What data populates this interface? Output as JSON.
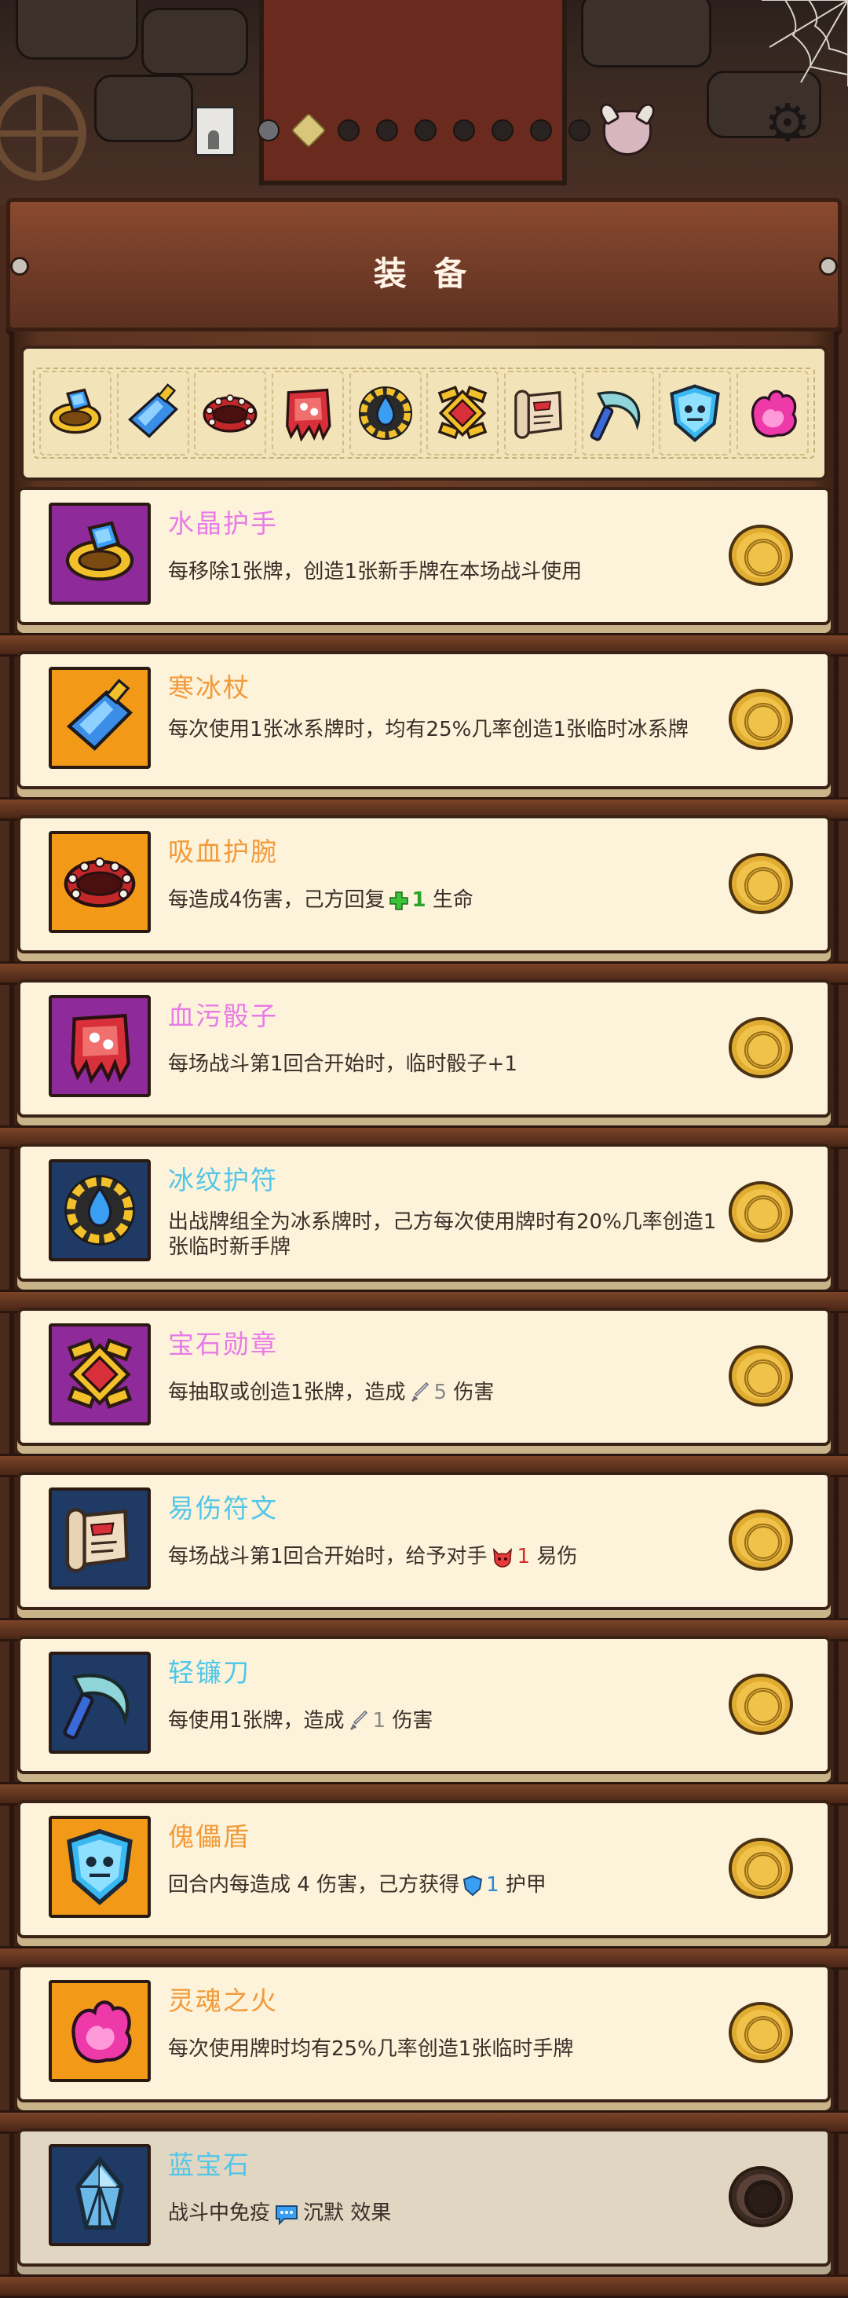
{
  "header": {
    "title": "装 备",
    "stage_dots": [
      {
        "state": "grey"
      },
      {
        "state": "active"
      },
      {
        "state": "dark"
      },
      {
        "state": "dark"
      },
      {
        "state": "dark"
      },
      {
        "state": "dark"
      },
      {
        "state": "dark"
      },
      {
        "state": "dark"
      },
      {
        "state": "dark"
      }
    ],
    "icons": [
      "castle-icon",
      "skull-icon",
      "gear-icon"
    ]
  },
  "equipped_bar": {
    "items": [
      "ring",
      "ice-staff",
      "bracelet",
      "dice",
      "amulet",
      "medal",
      "scroll",
      "sickle",
      "shield",
      "fire"
    ]
  },
  "colors": {
    "purple": "#8e2a9a",
    "orange": "#f29a18",
    "navy": "#1f3a64",
    "name_pink": "#e87ce6",
    "name_orange": "#f29a3a",
    "name_cyan": "#52c6e8"
  },
  "items": [
    {
      "name": "水晶护手",
      "desc": "每移除1张牌，创造1张新手牌在本场战斗使用",
      "name_color": "#e87ce6",
      "bg": "#8e2a9a",
      "icon": "ring-icon",
      "slot_state": "unlocked"
    },
    {
      "name": "寒冰杖",
      "desc": "每次使用1张冰系牌时，均有25%几率创造1张临时冰系牌",
      "name_color": "#f29a3a",
      "bg": "#f29a18",
      "icon": "ice-staff-icon",
      "slot_state": "unlocked"
    },
    {
      "name": "吸血护腕",
      "desc_pre": "每造成4伤害，己方回复",
      "desc_value": "1",
      "desc_post": "生命",
      "name_color": "#f29a3a",
      "bg": "#f29a18",
      "icon": "bracelet-icon",
      "slot_state": "unlocked"
    },
    {
      "name": "血污骰子",
      "desc": "每场战斗第1回合开始时，临时骰子+1",
      "name_color": "#e87ce6",
      "bg": "#8e2a9a",
      "icon": "dice-icon",
      "slot_state": "unlocked"
    },
    {
      "name": "冰纹护符",
      "desc": "出战牌组全为冰系牌时，己方每次使用牌时有20%几率创造1张临时新手牌",
      "name_color": "#52c6e8",
      "bg": "#1f3a64",
      "icon": "amulet-icon",
      "slot_state": "unlocked"
    },
    {
      "name": "宝石勋章",
      "desc_pre": "每抽取或创造1张牌，造成",
      "desc_value": "5",
      "desc_post": "伤害",
      "name_color": "#e87ce6",
      "bg": "#8e2a9a",
      "icon": "medal-icon",
      "slot_state": "unlocked"
    },
    {
      "name": "易伤符文",
      "desc_pre": "每场战斗第1回合开始时，给予对手",
      "desc_value": "1",
      "desc_post": "易伤",
      "name_color": "#52c6e8",
      "bg": "#1f3a64",
      "icon": "scroll-icon",
      "slot_state": "unlocked"
    },
    {
      "name": "轻镰刀",
      "desc_pre": "每使用1张牌，造成",
      "desc_value": "1",
      "desc_post": "伤害",
      "name_color": "#52c6e8",
      "bg": "#1f3a64",
      "icon": "sickle-icon",
      "slot_state": "unlocked"
    },
    {
      "name": "傀儡盾",
      "desc_pre": "回合内每造成 4 伤害，己方获得",
      "desc_value": "1",
      "desc_post": "护甲",
      "name_color": "#f29a3a",
      "bg": "#f29a18",
      "icon": "shield-icon",
      "slot_state": "unlocked"
    },
    {
      "name": "灵魂之火",
      "desc": "每次使用牌时均有25%几率创造1张临时手牌",
      "name_color": "#f29a3a",
      "bg": "#f29a18",
      "icon": "fire-icon",
      "slot_state": "unlocked"
    },
    {
      "name": "蓝宝石",
      "desc_pre": "战斗中免疫",
      "desc_value": "沉默",
      "desc_post": "效果",
      "name_color": "#52c6e8",
      "bg": "#1f3a64",
      "icon": "sapphire-icon",
      "slot_state": "locked"
    }
  ]
}
